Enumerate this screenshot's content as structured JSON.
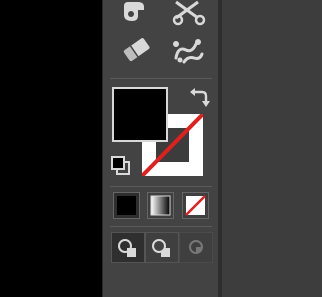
{
  "window": {
    "background": "#3c3c3c"
  },
  "colors": {
    "fill": "#000000",
    "stroke_none_slash": "#e0201f",
    "icon": "#d9d9d9",
    "icon_dim": "#777777"
  },
  "toolbar": {
    "tools": [
      {
        "name": "shape-builder-icon",
        "active": false
      },
      {
        "name": "scissors-icon",
        "active": false
      },
      {
        "name": "eraser-icon",
        "active": false
      },
      {
        "name": "puppet-warp-icon",
        "active": false
      }
    ],
    "fill_stroke": {
      "fill_color": "#000000",
      "stroke": "none",
      "swap_icon": "swap-arrow-icon",
      "default_icon": "default-colors-icon"
    },
    "color_modes": [
      {
        "name": "color-mode-button",
        "icon": "solid-color-icon",
        "selected": true
      },
      {
        "name": "gradient-mode-button",
        "icon": "gradient-icon",
        "selected": false
      },
      {
        "name": "none-mode-button",
        "icon": "none-icon",
        "selected": false
      }
    ],
    "draw_modes": [
      {
        "name": "draw-normal-button",
        "icon": "draw-normal-icon",
        "selected": true
      },
      {
        "name": "draw-behind-button",
        "icon": "draw-behind-icon",
        "selected": false
      },
      {
        "name": "draw-inside-button",
        "icon": "draw-inside-icon",
        "selected": false,
        "disabled": true
      }
    ],
    "more_icon": "more-tools-icon"
  }
}
